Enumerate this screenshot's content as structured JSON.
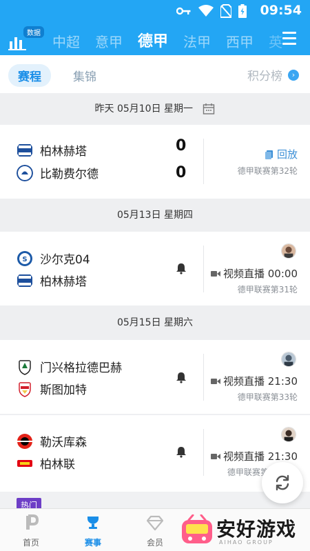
{
  "status_bar": {
    "time": "09:54"
  },
  "header": {
    "data_badge": "数据",
    "league_tabs": [
      "中超",
      "意甲",
      "德甲",
      "法甲",
      "西甲",
      "英"
    ],
    "active_league_index": 2
  },
  "subtabs": {
    "schedule": "赛程",
    "highlights": "集锦",
    "standings": "积分榜"
  },
  "sections": [
    {
      "date": "昨天 05月10日 星期一",
      "matches": [
        {
          "home": "柏林赫塔",
          "away": "比勒费尔德",
          "home_score": "0",
          "away_score": "0",
          "status": "回放",
          "round": "德甲联赛第32轮"
        }
      ]
    },
    {
      "date": "05月13日 星期四",
      "matches": [
        {
          "home": "沙尔克04",
          "away": "柏林赫塔",
          "status": "视频直播 00:00",
          "round": "德甲联赛第31轮"
        }
      ]
    },
    {
      "date": "05月15日 星期六",
      "matches": [
        {
          "home": "门兴格拉德巴赫",
          "away": "斯图加特",
          "status": "视频直播 21:30",
          "round": "德甲联赛第33轮"
        },
        {
          "home": "勒沃库森",
          "away": "柏林联",
          "status": "视频直播 21:30",
          "round": "德甲联赛第"
        }
      ]
    }
  ],
  "hot_tag": "热门",
  "bottom_nav": {
    "home": "首页",
    "matches": "赛事",
    "member": "会员"
  },
  "watermark": {
    "text": "安好游戏",
    "sub": "AIHAO GROUP"
  },
  "colors": {
    "brand_blue": "#23a6f4",
    "accent_blue": "#1a8ee8",
    "hot_purple": "#6d3ec6"
  }
}
